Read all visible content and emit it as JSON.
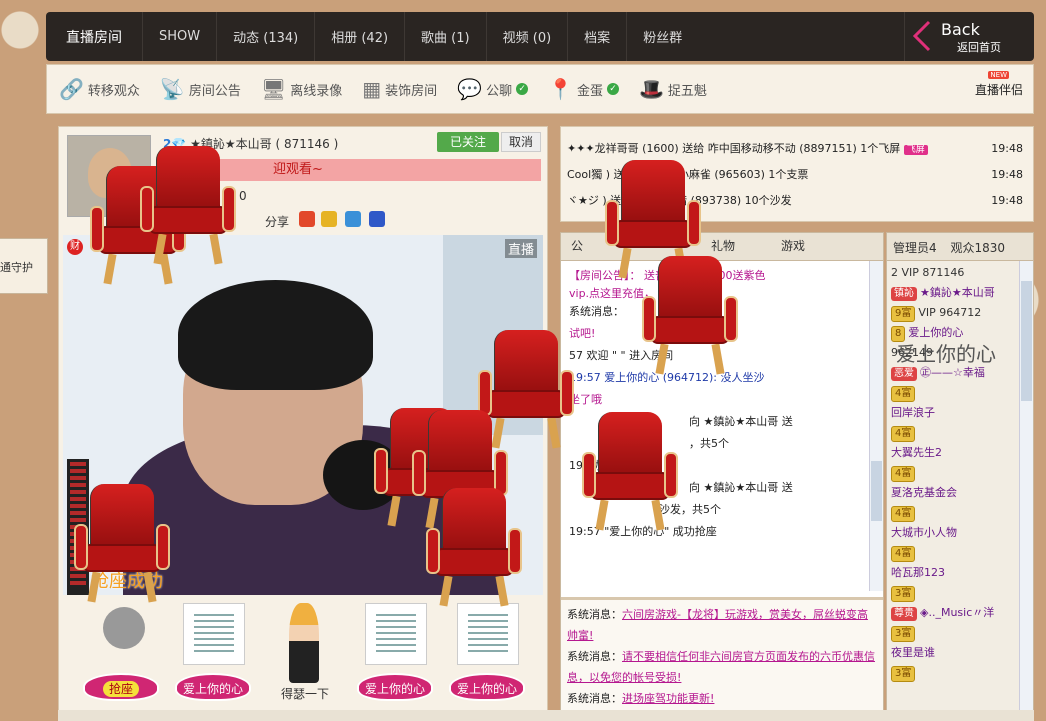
{
  "side_tab": "通守护",
  "nav": {
    "tabs": [
      "直播房间",
      "SHOW",
      "动态 (134)",
      "相册 (42)",
      "歌曲 (1)",
      "视频 (0)",
      "档案",
      "粉丝群"
    ],
    "back_label": "Back",
    "back_sub": "返回首页"
  },
  "toolbar": {
    "items": [
      "转移观众",
      "房间公告",
      "离线录像",
      "装饰房间",
      "公聊",
      "金蛋",
      "捉五魁"
    ],
    "partner": "直播伴侣",
    "new_badge": "NEW"
  },
  "anchor": {
    "level": "2",
    "name": "★鎮訫★本山哥",
    "id": "( 871146 )",
    "follow": "已关注",
    "cancel": "取消",
    "welcome": "迎观看~",
    "zero": "0",
    "share": "分享",
    "live": "直播",
    "wealth": "财",
    "grab_success": "抢座成功"
  },
  "seats": [
    {
      "label": "抢座"
    },
    {
      "label": "爱上你的心"
    },
    {
      "label": "得瑟一下"
    },
    {
      "label": "爱上你的心"
    },
    {
      "label": "爱上你的心"
    }
  ],
  "gifts": [
    {
      "text": "✦✦✦龙祥哥哥 (1600) 送给 咋中国移动移不动 (8897151) 1个飞屏",
      "badge": "飞屏",
      "time": "19:48"
    },
    {
      "text": "Cool獨 ) 送给 ♫. 漫步小麻雀 (965603) 1个支票",
      "time": "19:48"
    },
    {
      "text": "ヾ★ジ ) 送给 じ❤↓若惜 (893738) 10个沙发",
      "time": "19:48"
    }
  ],
  "chat": {
    "tabs": [
      "公",
      "礼物",
      "游戏"
    ],
    "lines": [
      "【房间公告】：  送普通vip，2000送紫色",
      "vip.点这里充值，",
      "系统消息：",
      "试吧!",
      "57 欢迎 \"                \" 进入房间",
      "19:57 爱上你的心 (964712):  没人坐沙",
      "坐了哦",
      "向 ★鎮訫★本山哥 送",
      "，共5个",
      "19:      功抢座",
      "向 ★鎮訫★本山哥 送",
      "沙发，共5个",
      "19:57 \"爱上你的心\" 成功抢座"
    ],
    "system": [
      {
        "prefix": "系统消息：",
        "text": "六间房游戏-【龙将】玩游戏，赏美女，屌丝蜕变高帅富!"
      },
      {
        "prefix": "系统消息：",
        "text": "请不要相信任何非六间房官方页面发布的六币优惠信息，以免您的帐号受损!"
      },
      {
        "prefix": "系统消息：",
        "text": "进场座驾功能更新!"
      }
    ]
  },
  "users": {
    "tabs": [
      "管理员4",
      "观众1830"
    ],
    "rows": [
      {
        "badge": "",
        "name": "2 VIP 871146"
      },
      {
        "badge": "镇訫",
        "name": "★鎮訫★本山哥"
      },
      {
        "badge": "9富",
        "name": "VIP 964712"
      },
      {
        "badge": "8",
        "name": "爱上你的心"
      },
      {
        "badge": "",
        "name": "962149"
      },
      {
        "badge": "恶爱",
        "name": "㊣——☆幸福"
      },
      {
        "badge": "4富",
        "name": ""
      },
      {
        "badge": "",
        "name": "回岸浪子"
      },
      {
        "badge": "4富",
        "name": ""
      },
      {
        "badge": "",
        "name": "大翼先生2"
      },
      {
        "badge": "4富",
        "name": ""
      },
      {
        "badge": "",
        "name": "夏洛克基金会"
      },
      {
        "badge": "4富",
        "name": ""
      },
      {
        "badge": "",
        "name": "大城市小人物"
      },
      {
        "badge": "4富",
        "name": ""
      },
      {
        "badge": "",
        "name": "哈瓦那123"
      },
      {
        "badge": "3富",
        "name": ""
      },
      {
        "badge": "尊贵",
        "name": "◈.._Music〃洋"
      },
      {
        "badge": "3富",
        "name": ""
      },
      {
        "badge": "",
        "name": "夜里是谁"
      },
      {
        "badge": "3富",
        "name": ""
      }
    ]
  },
  "overlay_text": "爱上你的心"
}
